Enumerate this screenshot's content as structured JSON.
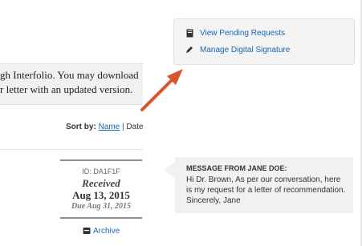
{
  "notice": {
    "line1": "gh Interfolio. You may download",
    "line2": "r letter with an updated version."
  },
  "sort": {
    "label": "Sort by:",
    "option_name": "Name",
    "separator": "|",
    "option_date": "Date"
  },
  "request_card": {
    "id": "ID: DA1F1F",
    "status": "Received",
    "date": "Aug 13, 2015",
    "due": "Due Aug 31, 2015",
    "archive_label": "Archive",
    "archive_icon": "archive-box-icon"
  },
  "actions": {
    "items": [
      {
        "label": "View Pending Requests",
        "icon": "document-icon"
      },
      {
        "label": "Manage Digital Signature",
        "icon": "pen-icon"
      }
    ]
  },
  "message": {
    "title": "MESSAGE FROM JANE DOE:",
    "body": "Hi Dr. Brown, As per our conversation, here is my request for a letter of recommendation. Sincerely, Jane"
  },
  "colors": {
    "link": "#1a67b3",
    "annotation_arrow": "#d9552b",
    "panel_bg": "#f3f3f3"
  }
}
